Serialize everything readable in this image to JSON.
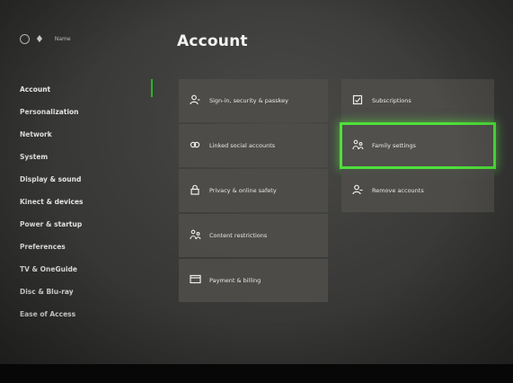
{
  "header": {
    "user_name": "Name",
    "title": "Account"
  },
  "sidebar": {
    "items": [
      {
        "label": "Account",
        "active": true
      },
      {
        "label": "Personalization"
      },
      {
        "label": "Network"
      },
      {
        "label": "System"
      },
      {
        "label": "Display & sound"
      },
      {
        "label": "Kinect & devices"
      },
      {
        "label": "Power & startup"
      },
      {
        "label": "Preferences"
      },
      {
        "label": "TV & OneGuide"
      },
      {
        "label": "Disc & Blu-ray"
      },
      {
        "label": "Ease of Access"
      }
    ]
  },
  "tiles_left": [
    {
      "label": "Sign-in, security & passkey",
      "icon": "person-key-icon"
    },
    {
      "label": "Linked social accounts",
      "icon": "linked-accounts-icon"
    },
    {
      "label": "Privacy & online safety",
      "icon": "lock-icon"
    },
    {
      "label": "Content restrictions",
      "icon": "family-icon"
    },
    {
      "label": "Payment & billing",
      "icon": "credit-card-icon"
    }
  ],
  "tiles_right": [
    {
      "label": "Subscriptions",
      "icon": "subscriptions-icon"
    },
    {
      "label": "Family settings",
      "icon": "family-icon",
      "focused": true
    },
    {
      "label": "Remove accounts",
      "icon": "remove-person-icon"
    }
  ],
  "colors": {
    "focus_highlight": "#4fe03a",
    "selected_marker": "#26b81f",
    "tile_background": "#4e4d4a"
  }
}
